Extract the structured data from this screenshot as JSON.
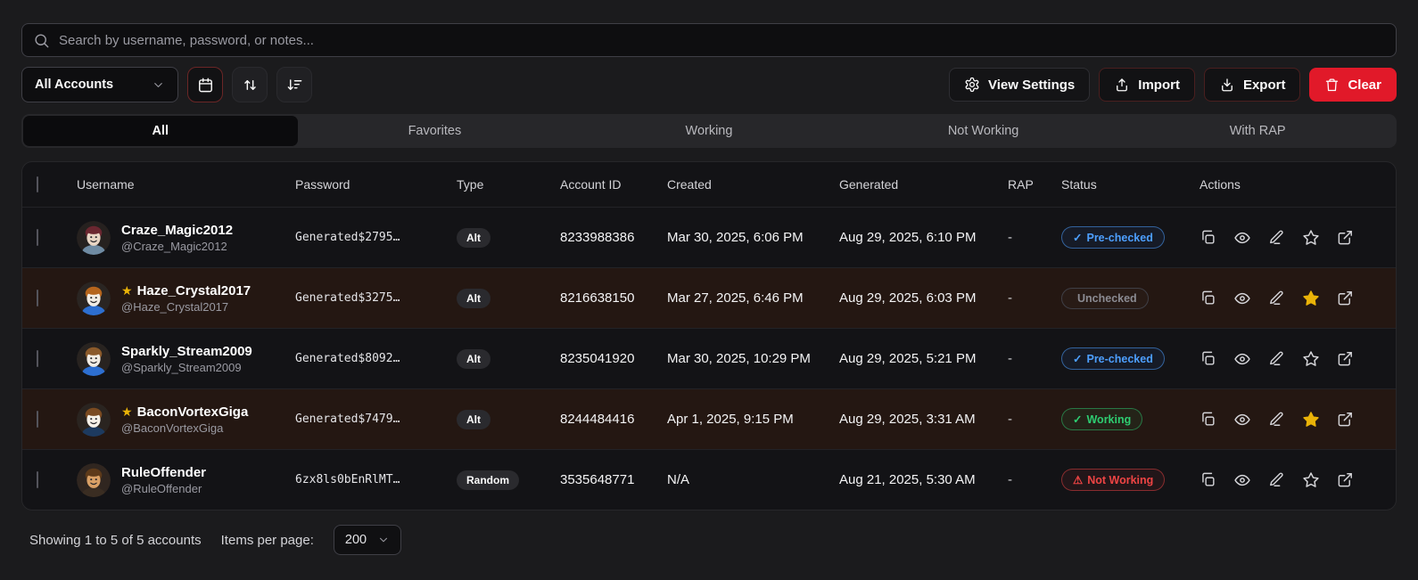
{
  "search": {
    "placeholder": "Search by username, password, or notes..."
  },
  "filters": {
    "account_filter_value": "All Accounts",
    "date_filter_icon": "calendar-icon",
    "sort_direction_icon": "arrows-up-down-icon",
    "sort_order_icon": "sort-descending-icon"
  },
  "toolbar": {
    "view_settings_label": "View Settings",
    "import_label": "Import",
    "export_label": "Export",
    "clear_label": "Clear"
  },
  "tabs": [
    {
      "label": "All",
      "active": true
    },
    {
      "label": "Favorites",
      "active": false
    },
    {
      "label": "Working",
      "active": false
    },
    {
      "label": "Not Working",
      "active": false
    },
    {
      "label": "With RAP",
      "active": false
    }
  ],
  "table": {
    "headers": [
      "Username",
      "Password",
      "Type",
      "Account ID",
      "Created",
      "Generated",
      "RAP",
      "Status",
      "Actions"
    ],
    "action_icons": [
      "copy-icon",
      "eye-icon",
      "edit-icon",
      "star-icon",
      "external-link-icon"
    ],
    "rows": [
      {
        "username": "Craze_Magic2012",
        "handle": "@Craze_Magic2012",
        "favorite": false,
        "password": "Generated$2795…",
        "type": "Alt",
        "account_id": "8233988386",
        "created": "Mar 30, 2025, 6:06 PM",
        "generated": "Aug 29, 2025, 6:10 PM",
        "rap": "-",
        "status": "Pre-checked",
        "status_kind": "prechecked",
        "status_icon": "✓",
        "avatar": {
          "bg": "#26211f",
          "hair": "#6b2730",
          "skin": "#e8d5c4",
          "shirt": "#6f8ba3"
        }
      },
      {
        "username": "Haze_Crystal2017",
        "handle": "@Haze_Crystal2017",
        "favorite": true,
        "password": "Generated$3275…",
        "type": "Alt",
        "account_id": "8216638150",
        "created": "Mar 27, 2025, 6:46 PM",
        "generated": "Aug 29, 2025, 6:03 PM",
        "rap": "-",
        "status": "Unchecked",
        "status_kind": "unchecked",
        "status_icon": "",
        "avatar": {
          "bg": "#2a2522",
          "hair": "#b5651d",
          "skin": "#f2ece4",
          "shirt": "#2d6fd1"
        }
      },
      {
        "username": "Sparkly_Stream2009",
        "handle": "@Sparkly_Stream2009",
        "favorite": false,
        "password": "Generated$8092…",
        "type": "Alt",
        "account_id": "8235041920",
        "created": "Mar 30, 2025, 10:29 PM",
        "generated": "Aug 29, 2025, 5:21 PM",
        "rap": "-",
        "status": "Pre-checked",
        "status_kind": "prechecked",
        "status_icon": "✓",
        "avatar": {
          "bg": "#282320",
          "hair": "#8b5a2b",
          "skin": "#f2ece4",
          "shirt": "#2d6fd1"
        }
      },
      {
        "username": "BaconVortexGiga",
        "handle": "@BaconVortexGiga",
        "favorite": true,
        "password": "Generated$7479…",
        "type": "Alt",
        "account_id": "8244484416",
        "created": "Apr 1, 2025, 9:15 PM",
        "generated": "Aug 29, 2025, 3:31 AM",
        "rap": "-",
        "status": "Working",
        "status_kind": "working",
        "status_icon": "✓",
        "avatar": {
          "bg": "#2a2420",
          "hair": "#7a4a21",
          "skin": "#f5f0e8",
          "shirt": "#1d3a5f"
        }
      },
      {
        "username": "RuleOffender",
        "handle": "@RuleOffender",
        "favorite": false,
        "password": "6zx8ls0bEnRlMT…",
        "type": "Random",
        "account_id": "3535648771",
        "created": "N/A",
        "generated": "Aug 21, 2025, 5:30 AM",
        "rap": "-",
        "status": "Not Working",
        "status_kind": "notworking",
        "status_icon": "⚠",
        "avatar": {
          "bg": "#302620",
          "hair": "#5d3a1a",
          "skin": "#d9a066",
          "shirt": "#3a2d22"
        }
      }
    ]
  },
  "footer": {
    "showing_text": "Showing 1 to 5 of 5 accounts",
    "items_per_page_label": "Items per page:",
    "items_per_page_value": "200"
  },
  "colors": {
    "danger_red": "#e11929",
    "favorite_gold": "#eab308",
    "status_blue": "#4d9fff",
    "status_green": "#2ecc71",
    "status_red": "#ef4444",
    "favorite_row_bg": "#241712"
  }
}
